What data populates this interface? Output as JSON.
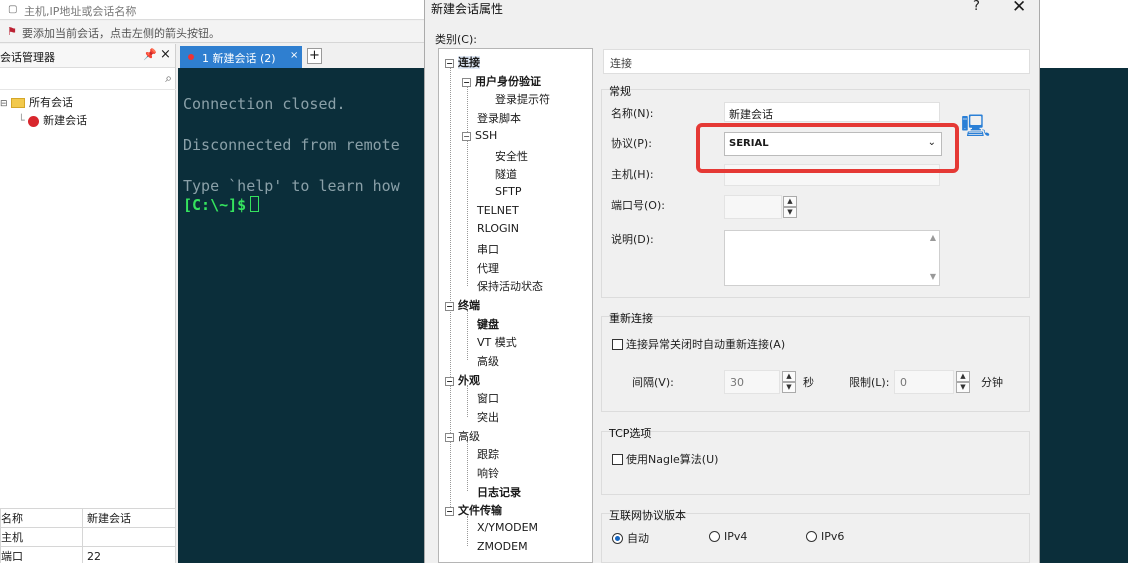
{
  "main": {
    "address_placeholder": "主机,IP地址或会话名称",
    "hint": "要添加当前会话，点击左侧的箭头按钮。",
    "session_manager": {
      "title": "会话管理器",
      "pin": "ᵖ",
      "close": "×",
      "all_sessions": "所有会话",
      "session_item": "新建会话"
    },
    "properties": [
      {
        "key": "名称",
        "value": "新建会话"
      },
      {
        "key": "主机",
        "value": ""
      },
      {
        "key": "端口",
        "value": "22"
      }
    ],
    "tab": {
      "label": "1 新建会话 (2)",
      "close": "×",
      "add": "+"
    },
    "terminal": {
      "lines": [
        "Connection closed.",
        "Disconnected from remote",
        "Type `help' to learn how"
      ],
      "prompt": "[C:\\~]$"
    }
  },
  "dialog": {
    "title": "新建会话属性",
    "help": "?",
    "close": "✕",
    "category_label": "类别(C):",
    "tree": {
      "connection": "连接",
      "user_auth": "用户身份验证",
      "login_prompt": "登录提示符",
      "login_script": "登录脚本",
      "ssh": "SSH",
      "security": "安全性",
      "tunnel": "隧道",
      "sftp": "SFTP",
      "telnet": "TELNET",
      "rlogin": "RLOGIN",
      "serial": "串口",
      "proxy": "代理",
      "keepalive": "保持活动状态",
      "terminal": "终端",
      "keyboard": "键盘",
      "vt_mode": "VT 模式",
      "advanced_t": "高级",
      "appearance": "外观",
      "window": "窗口",
      "highlight": "突出",
      "advanced": "高级",
      "trace": "跟踪",
      "bell": "响铃",
      "logging": "日志记录",
      "file_transfer": "文件传输",
      "xymodem": "X/YMODEM",
      "zmodem": "ZMODEM"
    },
    "header": "连接",
    "general": {
      "title": "常规",
      "name_label": "名称(N):",
      "name_value": "新建会话",
      "protocol_label": "协议(P):",
      "protocol_value": "SERIAL",
      "host_label": "主机(H):",
      "host_value": "",
      "port_label": "端口号(O):",
      "port_value": "",
      "desc_label": "说明(D):"
    },
    "reconnect": {
      "title": "重新连接",
      "checkbox": "连接异常关闭时自动重新连接(A)",
      "interval_label": "间隔(V):",
      "interval_value": "30",
      "interval_unit": "秒",
      "limit_label": "限制(L):",
      "limit_value": "0",
      "limit_unit": "分钟"
    },
    "tcp": {
      "title": "TCP选项",
      "checkbox": "使用Nagle算法(U)"
    },
    "ip": {
      "title": "互联网协议版本",
      "auto": "自动",
      "ipv4": "IPv4",
      "ipv6": "IPv6",
      "selected": "auto"
    }
  },
  "colors": {
    "highlight": "#e53935",
    "terminal_bg": "#0b2e3a",
    "prompt": "#35e35e",
    "tab_active": "#2f7fd0"
  }
}
